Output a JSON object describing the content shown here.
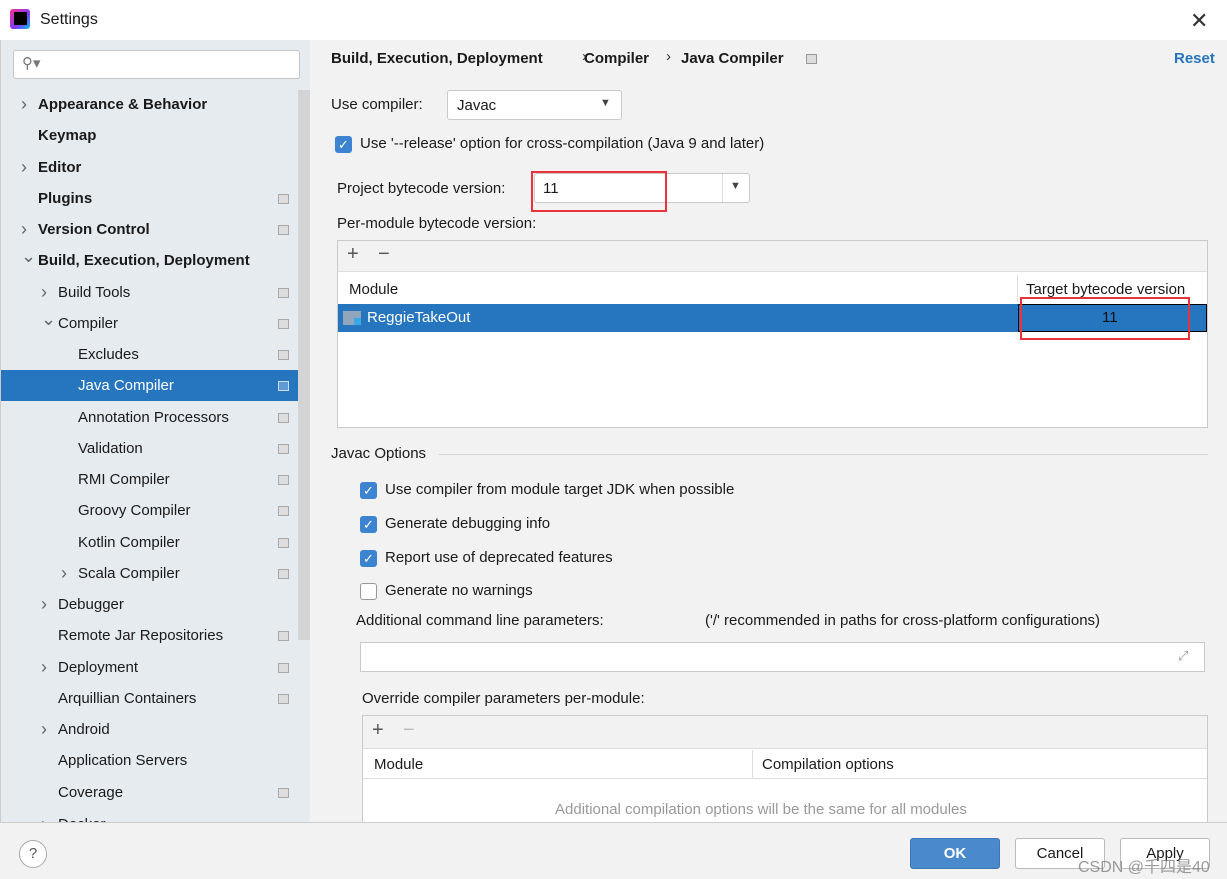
{
  "window": {
    "title": "Settings",
    "close_icon": "close-icon"
  },
  "sidebar": {
    "search_placeholder": "",
    "items": [
      {
        "label": "Appearance & Behavior",
        "level": 0,
        "chevron": "right",
        "bold": true,
        "page_icon": false
      },
      {
        "label": "Keymap",
        "level": 0,
        "chevron": "",
        "bold": true,
        "page_icon": false
      },
      {
        "label": "Editor",
        "level": 0,
        "chevron": "right",
        "bold": true,
        "page_icon": false
      },
      {
        "label": "Plugins",
        "level": 0,
        "chevron": "",
        "bold": true,
        "page_icon": true
      },
      {
        "label": "Version Control",
        "level": 0,
        "chevron": "right",
        "bold": true,
        "page_icon": true
      },
      {
        "label": "Build, Execution, Deployment",
        "level": 0,
        "chevron": "down",
        "bold": true,
        "page_icon": false
      },
      {
        "label": "Build Tools",
        "level": 1,
        "chevron": "right",
        "bold": false,
        "page_icon": true
      },
      {
        "label": "Compiler",
        "level": 1,
        "chevron": "down",
        "bold": false,
        "page_icon": true
      },
      {
        "label": "Excludes",
        "level": 2,
        "chevron": "",
        "bold": false,
        "page_icon": true
      },
      {
        "label": "Java Compiler",
        "level": 2,
        "chevron": "",
        "bold": false,
        "page_icon": true,
        "selected": true
      },
      {
        "label": "Annotation Processors",
        "level": 2,
        "chevron": "",
        "bold": false,
        "page_icon": true
      },
      {
        "label": "Validation",
        "level": 2,
        "chevron": "",
        "bold": false,
        "page_icon": true
      },
      {
        "label": "RMI Compiler",
        "level": 2,
        "chevron": "",
        "bold": false,
        "page_icon": true
      },
      {
        "label": "Groovy Compiler",
        "level": 2,
        "chevron": "",
        "bold": false,
        "page_icon": true
      },
      {
        "label": "Kotlin Compiler",
        "level": 2,
        "chevron": "",
        "bold": false,
        "page_icon": true
      },
      {
        "label": "Scala Compiler",
        "level": 2,
        "chevron": "right",
        "bold": false,
        "page_icon": true
      },
      {
        "label": "Debugger",
        "level": 1,
        "chevron": "right",
        "bold": false,
        "page_icon": false
      },
      {
        "label": "Remote Jar Repositories",
        "level": 1,
        "chevron": "",
        "bold": false,
        "page_icon": true
      },
      {
        "label": "Deployment",
        "level": 1,
        "chevron": "right",
        "bold": false,
        "page_icon": true
      },
      {
        "label": "Arquillian Containers",
        "level": 1,
        "chevron": "",
        "bold": false,
        "page_icon": true
      },
      {
        "label": "Android",
        "level": 1,
        "chevron": "right",
        "bold": false,
        "page_icon": false
      },
      {
        "label": "Application Servers",
        "level": 1,
        "chevron": "",
        "bold": false,
        "page_icon": false
      },
      {
        "label": "Coverage",
        "level": 1,
        "chevron": "",
        "bold": false,
        "page_icon": true
      },
      {
        "label": "Docker",
        "level": 1,
        "chevron": "right",
        "bold": false,
        "page_icon": false
      }
    ]
  },
  "breadcrumb": [
    "Build, Execution, Deployment",
    "Compiler",
    "Java Compiler"
  ],
  "reset_label": "Reset",
  "use_compiler": {
    "label": "Use compiler:",
    "value": "Javac"
  },
  "release_option": {
    "label": "Use '--release' option for cross-compilation (Java 9 and later)",
    "checked": true
  },
  "project_bytecode": {
    "label": "Project bytecode version:",
    "value": "11"
  },
  "per_module": {
    "label": "Per-module bytecode version:",
    "columns": [
      "Module",
      "Target bytecode version"
    ],
    "rows": [
      {
        "module": "ReggieTakeOut",
        "version": "11"
      }
    ]
  },
  "javac": {
    "section": "Javac Options",
    "options": [
      {
        "label": "Use compiler from module target JDK when possible",
        "checked": true
      },
      {
        "label": "Generate debugging info",
        "checked": true
      },
      {
        "label": "Report use of deprecated features",
        "checked": true
      },
      {
        "label": "Generate no warnings",
        "checked": false
      }
    ],
    "cmd_label": "Additional command line parameters:",
    "cmd_hint": "('/' recommended in paths for cross-platform configurations)",
    "cmd_value": "",
    "override_label": "Override compiler parameters per-module:",
    "override_columns": [
      "Module",
      "Compilation options"
    ],
    "override_empty": "Additional compilation options will be the same for all modules"
  },
  "footer": {
    "help": "?",
    "ok": "OK",
    "cancel": "Cancel",
    "apply": "Apply",
    "watermark": "CSDN @千四是40"
  },
  "colors": {
    "accent": "#2675bf",
    "highlight": "#e8333a"
  }
}
